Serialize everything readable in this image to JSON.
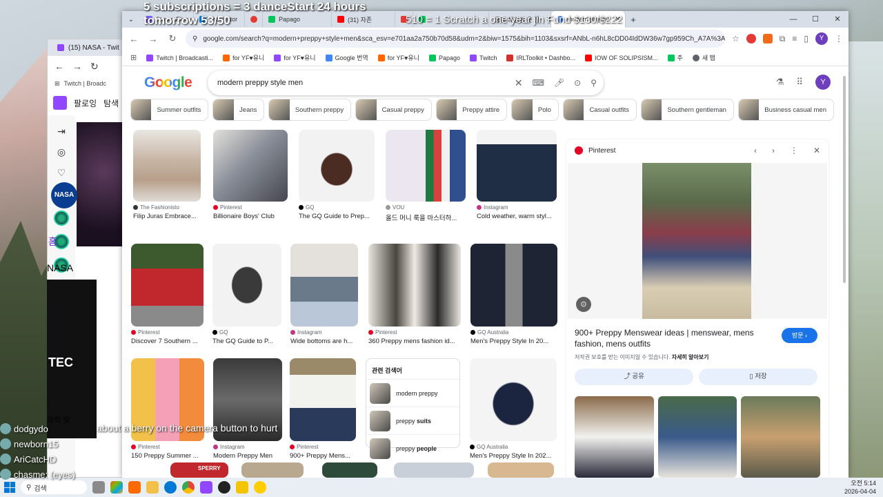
{
  "overlay": {
    "sub_line": "5 subscriptions = 3 danceStart 24 hours",
    "tomorrow_line": "tomorrow 53/50",
    "goal_line": "510 = 1 Scratch a one-year jin Fund $130/$222",
    "mid_text": "about a berry on the camera button to hurt",
    "chat": [
      "dodgydo",
      "newborn15",
      "AriCatcHD",
      "chasme: (eyes)"
    ]
  },
  "back_window": {
    "tab_title": "(15) NASA - Twit",
    "bookmark": "Twitch | Broadc",
    "twitch_nav": [
      "팔로잉",
      "탐색"
    ],
    "home_tab": "홈",
    "channel": "NASA",
    "tec": "TEC",
    "category": "과학 및"
  },
  "tabs": [
    {
      "title": "StreamElements",
      "color": "#7b61ff"
    },
    {
      "title": "Translator",
      "color": "#0078d4"
    },
    {
      "title": "",
      "color": "#e53935"
    },
    {
      "title": "Papago",
      "color": "#03c75a"
    },
    {
      "title": "(31) 자존",
      "color": "#ff0000"
    },
    {
      "title": "",
      "color": "#e53935"
    },
    {
      "title": "",
      "color": "#03c75a"
    },
    {
      "title": "룸메 체형별 옷 장",
      "color": "#777777"
    },
    {
      "title": "modern preppy",
      "color": "#4285f4",
      "active": true
    }
  ],
  "address": {
    "url": "google.com/search?q=modern+preppy+style+men&sca_esv=e701aa2a750b70d58&udm=2&biw=1575&bih=1103&sxsrf=ANbL-n6hL8cDD04IdDW36w7gp959Ch_A7A%3A1775...",
    "avatar": "Y"
  },
  "bookmarks": [
    {
      "label": "Twitch | Broadcasti...",
      "color": "#9146ff"
    },
    {
      "label": "for YF♥유니",
      "color": "#ff6600"
    },
    {
      "label": "for YF♥유니",
      "color": "#9146ff"
    },
    {
      "label": "Google 번역",
      "color": "#4285f4"
    },
    {
      "label": "for YF♥유니",
      "color": "#ff6600"
    },
    {
      "label": "Papago",
      "color": "#03c75a"
    },
    {
      "label": "Twitch",
      "color": "#9146ff"
    },
    {
      "label": "IRLToolkit • Dashbo...",
      "color": "#d32f2f"
    },
    {
      "label": "IOW OF SOLIPSISM...",
      "color": "#ff0000"
    },
    {
      "label": "주",
      "color": "#03c75a"
    },
    {
      "label": "새 탭",
      "color": "#5f6368"
    }
  ],
  "google": {
    "logo": "Google",
    "query": "modern preppy style men",
    "avatar": "Y"
  },
  "chips": [
    "Summer outfits",
    "Jeans",
    "Southern preppy",
    "Casual preppy",
    "Preppy attire",
    "Polo",
    "Casual outfits",
    "Southern gentleman",
    "Business casual men"
  ],
  "results": {
    "row1": [
      {
        "source": "The Fashionisto",
        "title": "Filip Juras Embrace...",
        "sicon": "#333333"
      },
      {
        "source": "Pinterest",
        "title": "Billionaire Boys' Club",
        "sicon": "#e60023"
      },
      {
        "source": "GQ",
        "title": "The GQ Guide to Prep...",
        "sicon": "#000000"
      },
      {
        "source": "VOU",
        "title": "올드 머니 룩을 마스터하...",
        "sicon": "#999999"
      },
      {
        "source": "Instagram",
        "title": "Cold weather, warm styl...",
        "sicon": "#c13584"
      }
    ],
    "row2": [
      {
        "source": "Pinterest",
        "title": "Discover 7 Southern ...",
        "sicon": "#e60023"
      },
      {
        "source": "GQ",
        "title": "The GQ Guide to P...",
        "sicon": "#000000"
      },
      {
        "source": "Instagram",
        "title": "Wide bottoms are h...",
        "sicon": "#c13584"
      },
      {
        "source": "Pinterest",
        "title": "360 Preppy mens fashion id...",
        "sicon": "#e60023"
      },
      {
        "source": "GQ Australia",
        "title": "Men's Preppy Style In 20...",
        "sicon": "#000000"
      }
    ],
    "row3": [
      {
        "source": "Pinterest",
        "title": "150 Preppy Summer ...",
        "sicon": "#e60023"
      },
      {
        "source": "Instagram",
        "title": "Modern Preppy Men",
        "sicon": "#c13584"
      },
      {
        "source": "Pinterest",
        "title": "900+ Preppy Mens...",
        "sicon": "#e60023"
      },
      {
        "source": "GQ Australia",
        "title": "Men's Preppy Style In 202...",
        "sicon": "#000000"
      }
    ],
    "row4_label": "SPERRY"
  },
  "related": {
    "heading": "관련 검색어",
    "items": [
      {
        "plain": "modern preppy",
        "bold": ""
      },
      {
        "plain": "preppy ",
        "bold": "suits"
      },
      {
        "plain": "preppy ",
        "bold": "people"
      }
    ]
  },
  "panel": {
    "source": "Pinterest",
    "title": "900+ Preppy Menswear ideas | menswear, mens fashion, mens outfits",
    "visit": "방문 ›",
    "note": "저작권 보호를 받는 이미지일 수 있습니다.",
    "note_link": "자세히 알아보기",
    "share": "공유",
    "save": "저장"
  },
  "taskbar": {
    "search": "검색",
    "time": "오전 5:14",
    "date": "2026-04-04"
  }
}
